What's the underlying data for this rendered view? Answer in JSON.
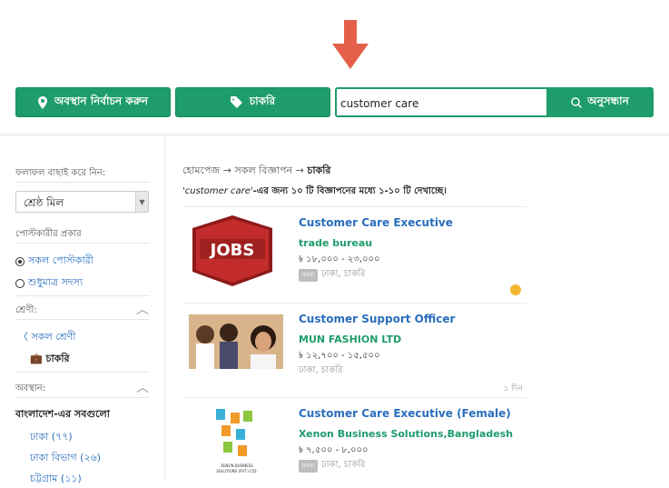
{
  "colors": {
    "accent": "#1e9c6b",
    "arrow": "#e5604a",
    "link": "#2a6ebd"
  },
  "topbar": {
    "location_label": "অবস্থান নির্বাচন করুন",
    "category_label": "চাকরি",
    "search_value": "customer care",
    "search_button": "অনুসন্ধান"
  },
  "sidebar": {
    "filter_label": "ফলাফল বাছাই করে নিন:",
    "sort_value": "শ্রেষ্ঠ মিল",
    "poster_type_label": "পোস্টকারীর প্রকার",
    "poster_all": "সকল পোস্টকারী",
    "poster_members": "শুধুমাত্র সদস্য",
    "category_label": "শ্রেণী:",
    "all_categories": "সকল শ্রেণী",
    "current_category": "চাকরি",
    "location_label": "অবস্থান:",
    "loc_all": "বাংলাদেশ-এর সবগুলো",
    "loc_dhaka": "ঢাকা (৭৭)",
    "loc_dhaka_div": "ঢাকা বিভাগ (২৬)",
    "loc_ctg": "চট্টগ্রাম (১১)"
  },
  "main": {
    "breadcrumb_home": "হোমপেজ",
    "breadcrumb_all": "সকল বিজ্ঞাপন",
    "breadcrumb_current": "চাকরি",
    "summary_query": "'customer care'",
    "summary_rest": "-এর জন্য ১০ টি বিজ্ঞাপনের মধ্যে ১-১০ টি দেখাচ্ছে।",
    "listings": [
      {
        "thumb": "JOBS",
        "title": "Customer Care Executive",
        "company": "trade bureau",
        "salary": "৳ ১৮,০০০ - ২৩,০০০",
        "badge": "সদস্য",
        "location": "ঢাকা, চাকরি",
        "time": ""
      },
      {
        "thumb": "photo",
        "title": "Customer Support Officer",
        "company": "MUN FASHION LTD",
        "salary": "৳ ১২,৭০০ - ১৫,৫০০",
        "badge": "",
        "location": "ঢাকা, চাকরি",
        "time": "১ দিন"
      },
      {
        "thumb": "XENON BUSINESS SOLUTIONS (PVT.) LTD.",
        "title": "Customer Care Executive (Female)",
        "company": "Xenon Business Solutions,Bangladesh",
        "salary": "৳ ৭,৫০০ - ৮,০০০",
        "badge": "সদস্য",
        "location": "ঢাকা, চাকরি",
        "time": ""
      }
    ]
  }
}
